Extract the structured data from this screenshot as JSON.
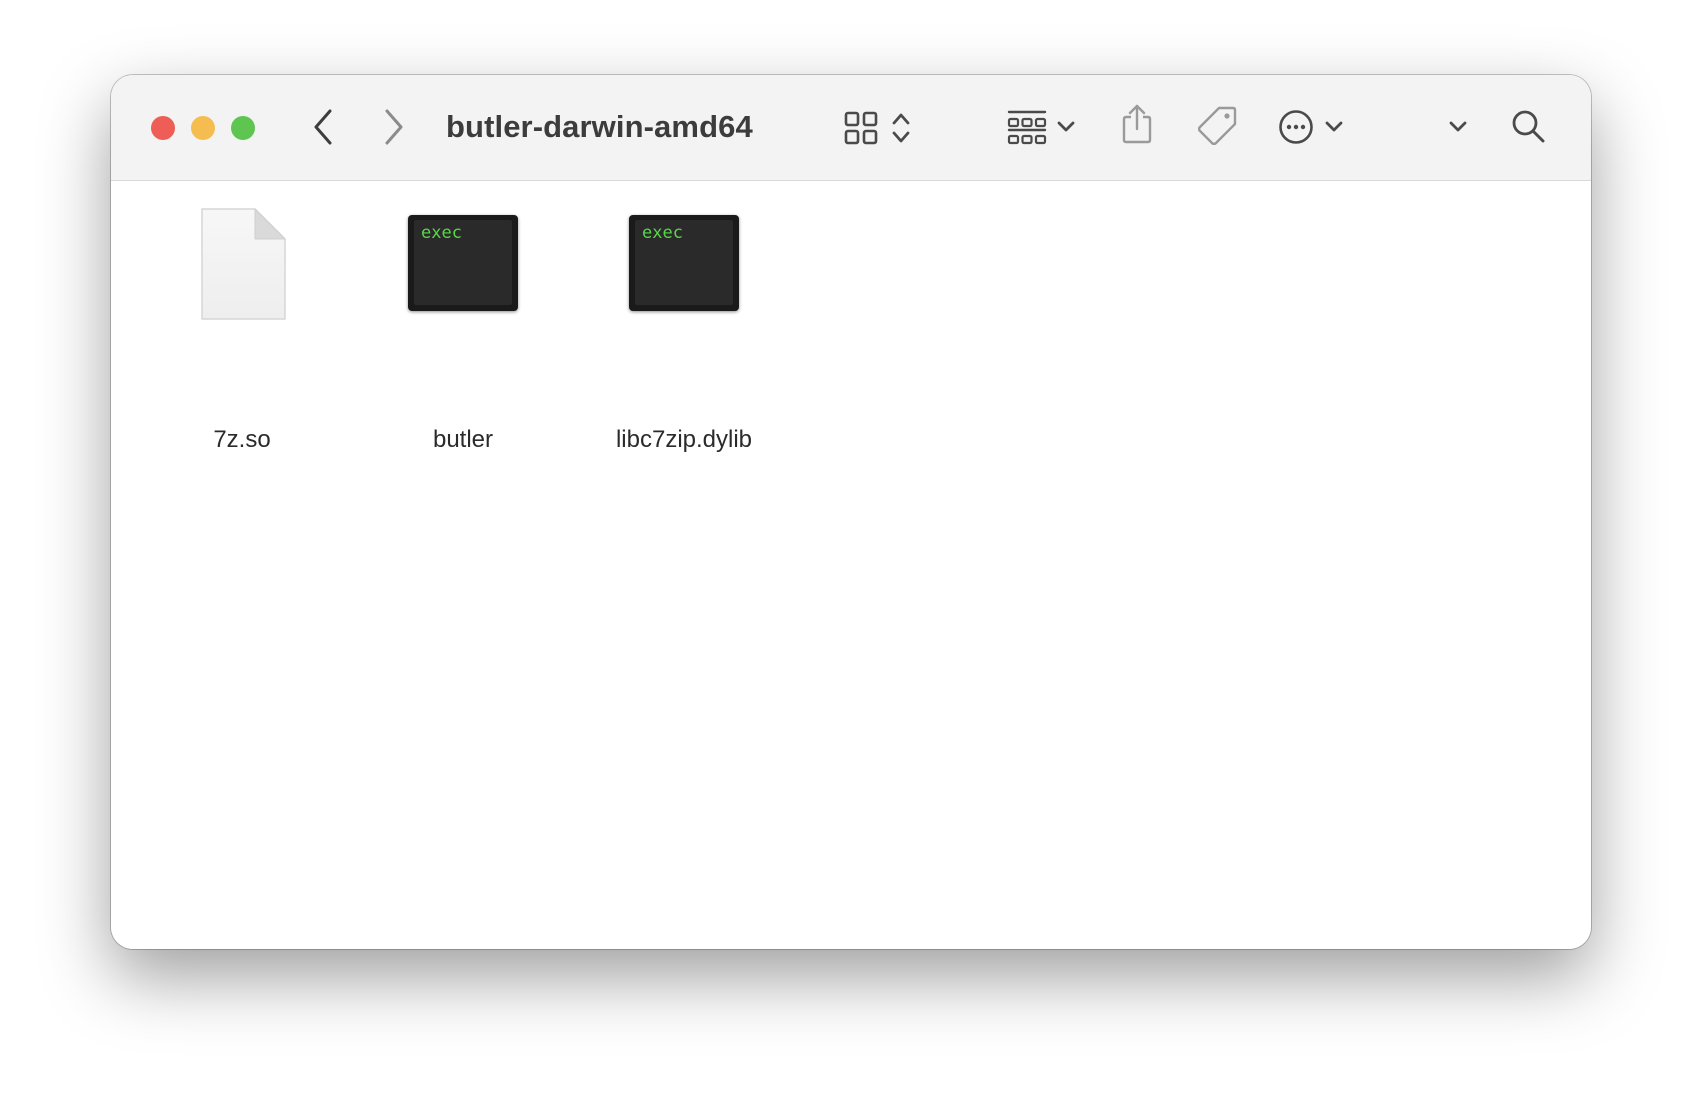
{
  "window": {
    "title": "butler-darwin-amd64"
  },
  "traffic_lights": {
    "close_color": "#ee5e56",
    "minimize_color": "#f5bd4f",
    "zoom_color": "#5fc551"
  },
  "toolbar": {
    "icons": [
      "chevron-left-icon",
      "chevron-right-icon",
      "grid-view-icon",
      "updown-chevron-icon",
      "group-icon",
      "chevron-down-icon",
      "share-icon",
      "tag-icon",
      "more-icon",
      "chevron-down-icon",
      "chevron-down-icon",
      "search-icon"
    ]
  },
  "files": [
    {
      "name": "7z.so",
      "kind": "document",
      "badge": ""
    },
    {
      "name": "butler",
      "kind": "executable",
      "badge": "exec"
    },
    {
      "name": "libc7zip.dylib",
      "kind": "executable",
      "badge": "exec"
    }
  ]
}
